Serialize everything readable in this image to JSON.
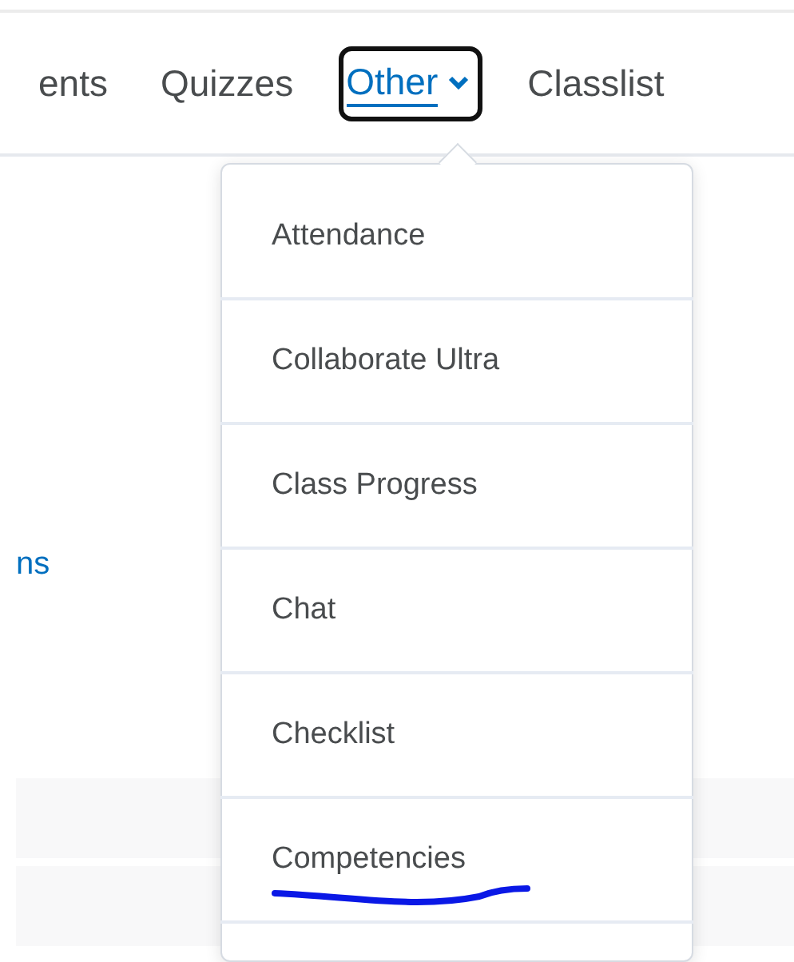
{
  "tabs": [
    {
      "label": "ents",
      "kind": "link",
      "selected": false
    },
    {
      "label": "Quizzes",
      "kind": "link",
      "selected": false
    },
    {
      "label": "Other",
      "kind": "dropdown",
      "selected": true
    },
    {
      "label": "Classlist",
      "kind": "link",
      "selected": false
    }
  ],
  "content": {
    "link": "ns"
  },
  "menu": {
    "items": [
      {
        "label": "Attendance",
        "annotated": false
      },
      {
        "label": "Collaborate Ultra",
        "annotated": false
      },
      {
        "label": "Class Progress",
        "annotated": false
      },
      {
        "label": "Chat",
        "annotated": false
      },
      {
        "label": "Checklist",
        "annotated": false
      },
      {
        "label": "Competencies",
        "annotated": true
      }
    ]
  }
}
